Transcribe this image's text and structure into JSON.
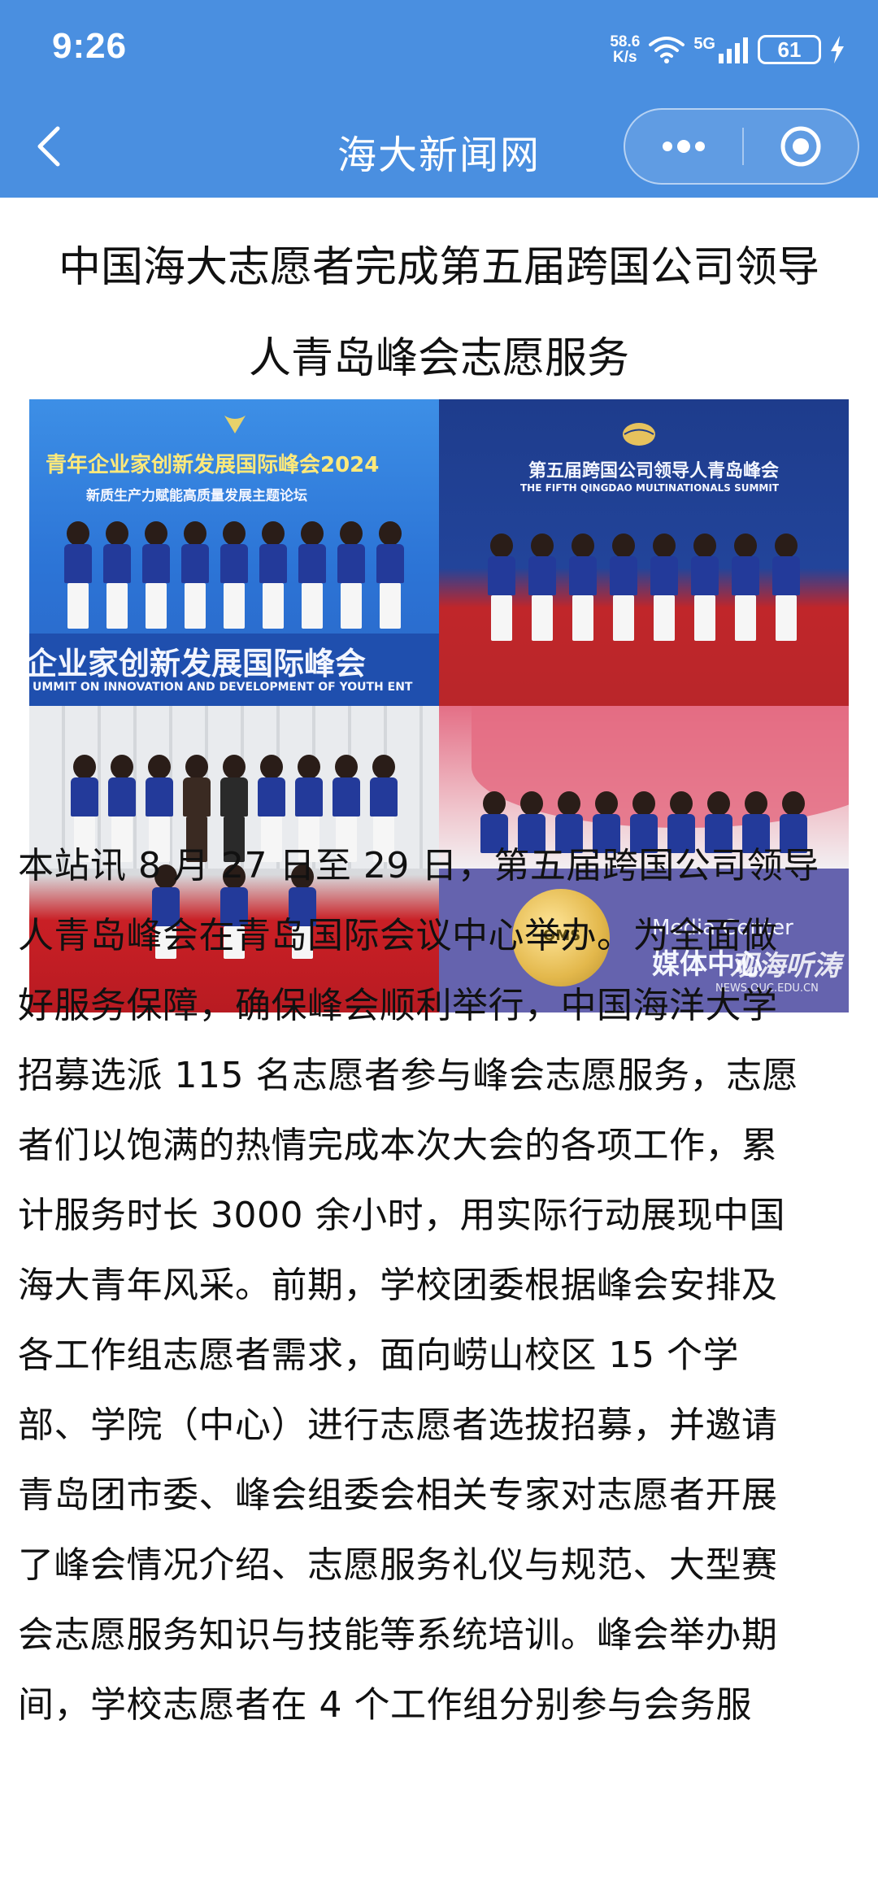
{
  "status_bar": {
    "time": "9:26",
    "net_speed_value": "58.6",
    "net_speed_unit": "K/s",
    "network": "5G",
    "battery": "61"
  },
  "nav": {
    "title": "海大新闻网",
    "icons": [
      "back-icon",
      "more-icon",
      "close-target-icon"
    ]
  },
  "article": {
    "headline_lines": [
      "中国海大志愿者完成第五届跨国公司领导",
      "人青岛峰会志愿服务"
    ],
    "photo": {
      "panel1_sign_cn": "青年企业家创新发展国际峰会2024",
      "panel1_sign_sub": "新质生产力赋能高质量发展主题论坛",
      "panel1_bottom_cn": "企业家创新发展国际峰会",
      "panel1_bottom_en": "UMMIT ON INNOVATION AND DEVELOPMENT OF YOUTH ENT",
      "panel2_sign_cn": "第五届跨国公司领导人青岛峰会",
      "panel2_sign_en": "THE FIFTH QINGDAO MULTINATIONALS SUMMIT",
      "panel4_logo": "QMS",
      "panel4_media_en": "Media Center",
      "panel4_media_cn": "媒体中心",
      "panel4_watermark_cn": "观海听涛",
      "panel4_watermark_url": "NEWS.OUC.EDU.CN"
    },
    "body_lines": [
      "本站讯 8 月 27 日至 29 日，第五届跨国公司领导",
      "人青岛峰会在青岛国际会议中心举办。为全面做",
      "好服务保障，确保峰会顺利举行，中国海洋大学",
      "招募选派 115 名志愿者参与峰会志愿服务，志愿",
      "者们以饱满的热情完成本次大会的各项工作，累",
      "计服务时长 3000 余小时，用实际行动展现中国",
      "海大青年风采。前期，学校团委根据峰会安排及",
      "各工作组志愿者需求，面向崂山校区 15 个学",
      "部、学院（中心）进行志愿者选拔招募，并邀请",
      "青岛团市委、峰会组委会相关专家对志愿者开展",
      "了峰会情况介绍、志愿服务礼仪与规范、大型赛",
      "会志愿服务知识与技能等系统培训。峰会举办期",
      "间，学校志愿者在 4 个工作组分别参与会务服"
    ]
  }
}
